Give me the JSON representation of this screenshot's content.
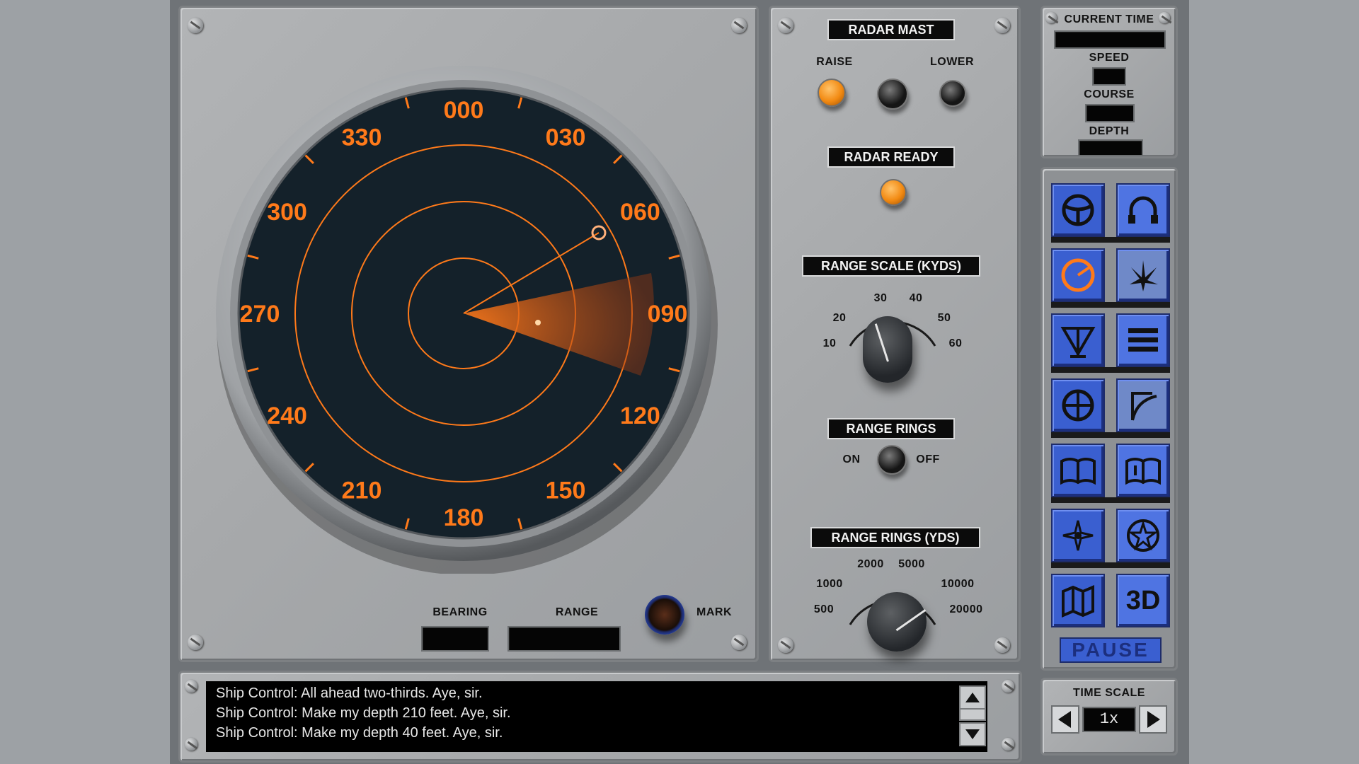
{
  "radar_panel": {
    "headings": [
      "000",
      "030",
      "060",
      "090",
      "120",
      "150",
      "180",
      "210",
      "240",
      "270",
      "300",
      "330"
    ],
    "bearing_label": "BEARING",
    "range_label": "RANGE",
    "mark_label": "MARK"
  },
  "radar_mast": {
    "title": "RADAR MAST",
    "raise_label": "RAISE",
    "lower_label": "LOWER",
    "ready_title": "RADAR READY"
  },
  "range_scale": {
    "title": "RANGE SCALE (KYDS)",
    "ticks": [
      "10",
      "20",
      "30",
      "40",
      "50",
      "60"
    ]
  },
  "range_rings": {
    "title": "RANGE RINGS",
    "on_label": "ON",
    "off_label": "OFF"
  },
  "range_rings_yds": {
    "title": "RANGE RINGS (YDS)",
    "ticks": [
      "500",
      "1000",
      "2000",
      "5000",
      "10000",
      "20000"
    ]
  },
  "status": {
    "current_time_label": "CURRENT TIME",
    "speed_label": "SPEED",
    "course_label": "COURSE",
    "depth_label": "DEPTH"
  },
  "stations": {
    "pause_label": "PAUSE",
    "threed_label": "3D",
    "icons": [
      "ship-control-icon",
      "sonar-icon",
      "radar-icon",
      "periscope-icon",
      "torpedo-icon",
      "weapons-list-icon",
      "target-icon",
      "chart-icon",
      "manual-icon",
      "log-icon",
      "compass-icon",
      "medal-icon",
      "map-icon",
      "3d-view-icon"
    ]
  },
  "time_scale": {
    "title": "TIME SCALE",
    "value": "1x"
  },
  "messages": [
    "Ship Control: All ahead two-thirds.  Aye, sir.",
    "Ship Control: Make my depth 210 feet.  Aye, sir.",
    "Ship Control: Make my depth 40 feet.  Aye, sir."
  ],
  "colors": {
    "accent_orange": "#ff7a1a",
    "scope_bg": "#14212a",
    "station_blue": "#3a5fd0"
  }
}
